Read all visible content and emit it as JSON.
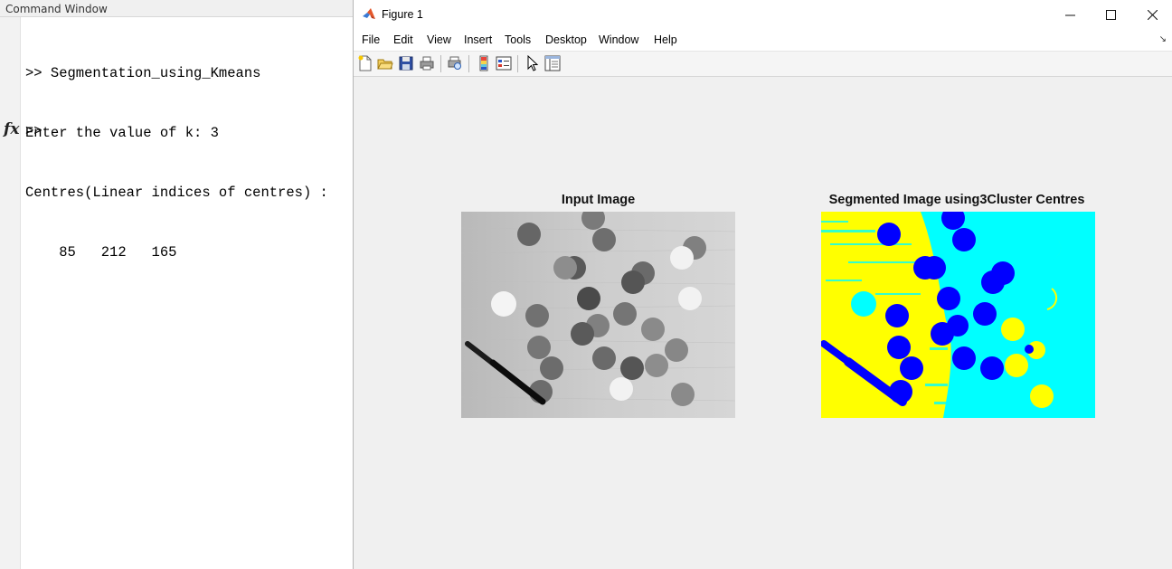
{
  "command_window": {
    "title": "Command Window",
    "lines": [
      ">> Segmentation_using_Kmeans",
      "Enter the value of k: 3",
      "Centres(Linear indices of centres) :",
      "    85   212   165"
    ],
    "fx_label": "fx",
    "prompt": ">>"
  },
  "figure": {
    "title": "Figure 1",
    "menu": [
      "File",
      "Edit",
      "View",
      "Insert",
      "Tools",
      "Desktop",
      "Window",
      "Help"
    ],
    "toolbar_icons": [
      "new-figure-icon",
      "open-file-icon",
      "save-icon",
      "print-icon",
      "print-preview-icon",
      "colorbar-icon",
      "legend-icon",
      "pointer-icon",
      "property-editor-icon"
    ],
    "axes": [
      {
        "title": "Input Image"
      },
      {
        "title": "Segmented Image using3Cluster Centres"
      }
    ],
    "segment_colors": {
      "background_left": "#ffff00",
      "background_right": "#00ffff",
      "objects": "#0000ff"
    }
  }
}
